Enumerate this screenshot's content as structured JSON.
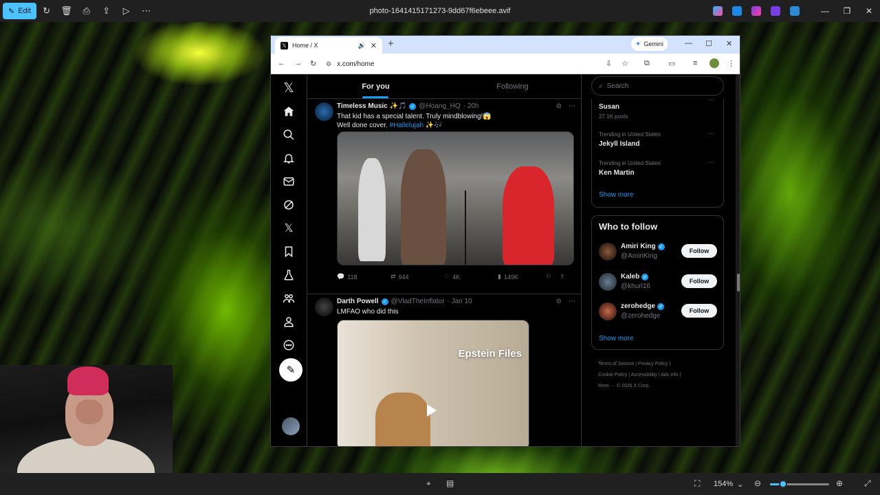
{
  "viewer": {
    "edit_label": "Edit",
    "file_title": "photo-1641415171273-9dd67f6ebeee.avif",
    "zoom_level": "154%",
    "zoom_fraction": 0.22,
    "accent_color": "#4cc2ff"
  },
  "browser": {
    "tab_title": "Home / X",
    "gemini_label": "Gemini",
    "url": "x.com/home"
  },
  "x_app": {
    "tabs": {
      "for_you": "For you",
      "following": "Following"
    },
    "nav_icons": [
      "x-logo-icon",
      "home-icon",
      "search-icon",
      "notifications-icon",
      "messages-icon",
      "grok-icon",
      "x-premium-icon",
      "bookmarks-icon",
      "jobs-icon",
      "communities-icon",
      "profile-icon",
      "more-icon"
    ],
    "tweets": [
      {
        "name": "Timeless Music ✨🎵",
        "handle": "@Hoang_HQ",
        "time": "· 20h",
        "text_line1": "That kid has a special talent. Truly mindblowing!😱",
        "text_line2_prefix": "Well done cover. ",
        "hashtag": "#Hallelujah",
        "text_line2_suffix": " ✨🎶",
        "replies": "118",
        "reposts": "944",
        "likes": "4K",
        "views": "149K"
      },
      {
        "name": "Darth Powell",
        "handle": "@VladTheInflator",
        "time": "· Jan 10",
        "text_line1": "LMFAO who did this",
        "media_caption": "Epstein Files"
      }
    ],
    "search_placeholder": "Search",
    "trends": [
      {
        "name": "Susan",
        "posts": "27.1K posts"
      },
      {
        "label": "Trending in United States",
        "name": "Jekyll Island"
      },
      {
        "label": "Trending in United States",
        "name": "Ken Martin"
      }
    ],
    "show_more": "Show more",
    "who_to_follow": {
      "title": "Who to follow",
      "follow_label": "Follow",
      "accounts": [
        {
          "name": "Amiri King",
          "handle": "@AmiriKing"
        },
        {
          "name": "Kaleb",
          "handle": "@khurl16"
        },
        {
          "name": "zerohedge",
          "handle": "@zerohedge"
        }
      ]
    },
    "footer": {
      "terms": "Terms of Service",
      "privacy": "Privacy Policy",
      "cookie": "Cookie Policy",
      "accessibility": "Accessibility",
      "ads": "Ads info",
      "more": "More ···",
      "copyright": "© 2026 X Corp."
    },
    "link_color": "#1d9bf0"
  }
}
